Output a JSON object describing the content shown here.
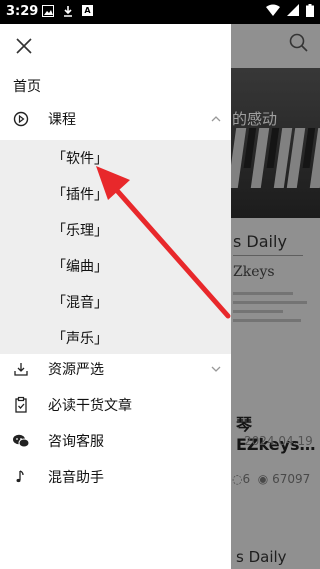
{
  "status_bar": {
    "time": "3:29",
    "notification_icons": [
      "photo-icon",
      "download-icon",
      "app-a-icon"
    ],
    "a_badge": "A",
    "system_icons": [
      "wifi-icon",
      "signal-icon",
      "battery-icon"
    ]
  },
  "background": {
    "banner_text": "的感动",
    "card_title_1": "s Daily",
    "card_subtitle_1": "Zkeys",
    "article_title": "琴EZkeys…",
    "article_date": "2024.04.19",
    "comment_count": "6",
    "view_count": "67097",
    "card_title_2": "s Daily"
  },
  "drawer": {
    "home": "首页",
    "course": {
      "label": "课程",
      "expanded": true,
      "subitems": [
        "「软件」",
        "「插件」",
        "「乐理」",
        "「编曲」",
        "「混音」",
        "「声乐」"
      ]
    },
    "resources": {
      "label": "资源严选",
      "expanded": false
    },
    "articles": {
      "label": "必读干货文章"
    },
    "service": {
      "label": "咨询客服"
    },
    "mixing": {
      "label": "混音助手"
    }
  },
  "colors": {
    "annotation_arrow": "#e8282b",
    "submenu_bg": "#eeeeee",
    "scrim": "rgba(0,0,0,0.38)"
  }
}
